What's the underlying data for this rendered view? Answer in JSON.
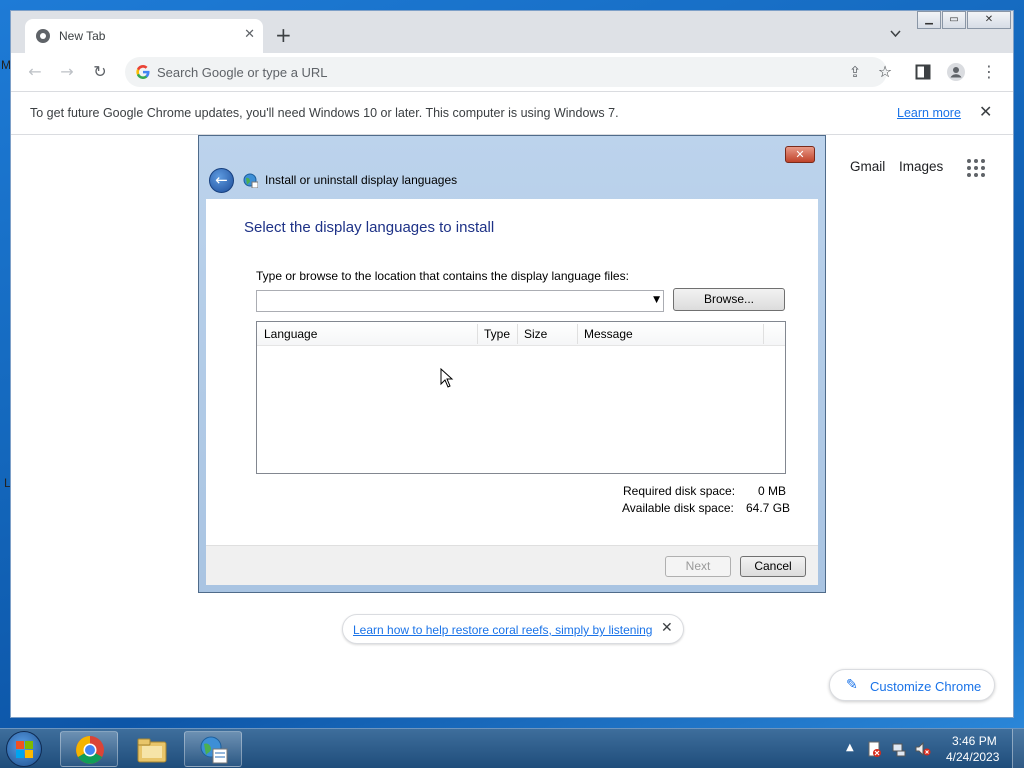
{
  "desktop": {
    "glimpse_text_1": "M",
    "glimpse_text_2": "L"
  },
  "browser": {
    "tab": {
      "title": "New Tab",
      "icon": "chrome-icon"
    },
    "window_controls": {
      "minimize": "▁",
      "restore": "▭",
      "close": "✕"
    },
    "omnibox": {
      "placeholder": "Search Google or type a URL",
      "value": ""
    },
    "infobar": {
      "message": "To get future Google Chrome updates, you'll need Windows 10 or later. This computer is using Windows 7.",
      "link": "Learn more"
    },
    "newtab": {
      "gmail": "Gmail",
      "images": "Images",
      "promo_link": "Learn how to help restore coral reefs, simply by listening",
      "customize": "Customize Chrome"
    }
  },
  "dialog": {
    "title": "Install or uninstall display languages",
    "heading": "Select the display languages to install",
    "prompt": "Type or browse to the location that contains the display language files:",
    "location_value": "",
    "browse_button": "Browse...",
    "columns": [
      "Language",
      "Type",
      "Size",
      "Message"
    ],
    "rows": [],
    "required_label": "Required disk space:",
    "required_value": "0 MB",
    "available_label": "Available disk space:",
    "available_value": "64.7 GB",
    "next_button": "Next",
    "cancel_button": "Cancel",
    "next_enabled": false
  },
  "taskbar": {
    "pinned": [
      "chrome-icon",
      "file-explorer-icon",
      "language-setup-icon"
    ],
    "clock_time": "3:46 PM",
    "clock_date": "4/24/2023"
  }
}
